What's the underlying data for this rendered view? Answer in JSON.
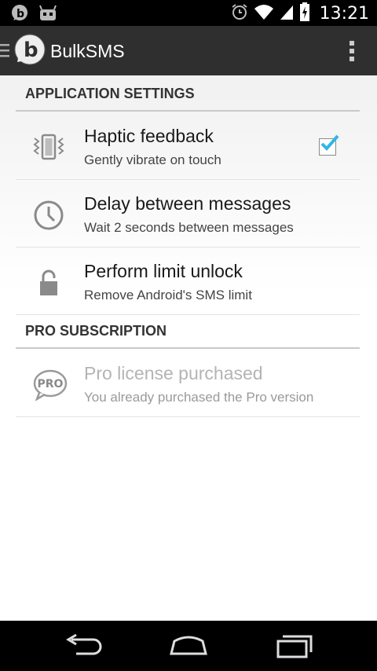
{
  "status_bar": {
    "time": "13:21"
  },
  "action_bar": {
    "app_title": "BulkSMS",
    "overflow_icon": "more-vertical-icon"
  },
  "sections": [
    {
      "header": "APPLICATION SETTINGS",
      "items": [
        {
          "title": "Haptic feedback",
          "summary": "Gently vibrate on touch",
          "icon": "vibrate-icon",
          "checked": true
        },
        {
          "title": "Delay between messages",
          "summary": "Wait 2 seconds between messages",
          "icon": "clock-icon"
        },
        {
          "title": "Perform limit unlock",
          "summary": "Remove Android's SMS limit",
          "icon": "lock-icon"
        }
      ]
    },
    {
      "header": "PRO SUBSCRIPTION",
      "items": [
        {
          "title": "Pro license purchased",
          "summary": "You already purchased the Pro version",
          "icon": "pro-badge-icon",
          "disabled": true
        }
      ]
    }
  ],
  "pro_badge_text": "PRO",
  "colors": {
    "checkmark": "#33b5e5",
    "action_bar": "#2f2f2f"
  }
}
